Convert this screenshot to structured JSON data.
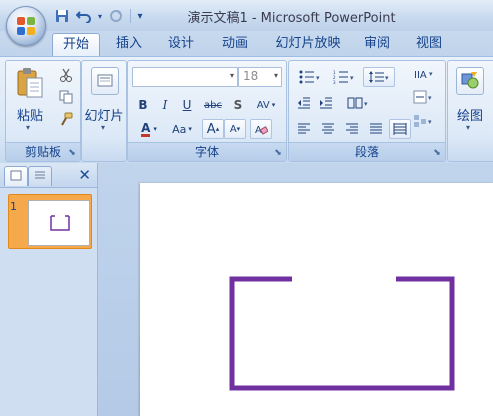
{
  "window": {
    "title": "演示文稿1 - Microsoft PowerPoint"
  },
  "quick_access": {
    "icons": [
      "save-icon",
      "undo-icon",
      "redo-icon",
      "customize-icon"
    ]
  },
  "tabs": [
    "开始",
    "插入",
    "设计",
    "动画",
    "幻灯片放映",
    "审阅",
    "视图"
  ],
  "active_tab": "开始",
  "ribbon": {
    "clipboard": {
      "group_label": "剪贴板",
      "paste_label": "粘贴"
    },
    "slides": {
      "new_slide_label": "幻灯片"
    },
    "font": {
      "group_label": "字体",
      "font_name": "",
      "font_size": "18",
      "bold": "B",
      "italic": "I",
      "underline": "U",
      "strike": "abc",
      "shadow": "S",
      "spacing": "AV",
      "color": "A",
      "case": "Aa",
      "grow": "A",
      "shrink": "A"
    },
    "paragraph": {
      "group_label": "段落"
    },
    "drawing": {
      "draw_label": "绘图"
    }
  },
  "slide_panel": {
    "slide_numbers": [
      "1"
    ]
  },
  "colors": {
    "shape_stroke": "#7030a0",
    "selection": "#f5a94a",
    "ribbon_text": "#15428b"
  }
}
